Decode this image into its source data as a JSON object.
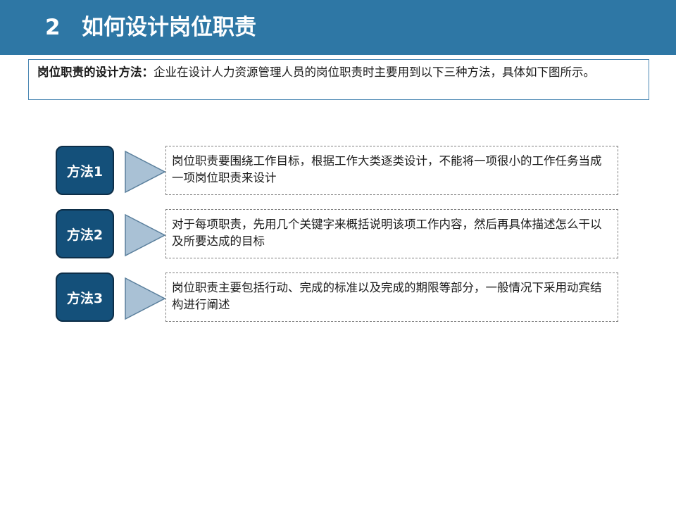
{
  "header": {
    "number": "2",
    "title": "如何设计岗位职责",
    "color": "#2e77a5"
  },
  "intro": {
    "lead": "岗位职责的设计方法：",
    "text": "企业在设计人力资源管理人员的岗位职责时主要用到以下三种方法，具体如下图所示。"
  },
  "methods": [
    {
      "label": "方法1",
      "text": "岗位职责要围绕工作目标，根据工作大类逐类设计，不能将一项很小的工作任务当成一项岗位职责来设计"
    },
    {
      "label": "方法2",
      "text": "对于每项职责，先用几个关键字来概括说明该项工作内容，然后再具体描述怎么干以及所要达成的目标"
    },
    {
      "label": "方法3",
      "text": "岗位职责主要包括行动、完成的标准以及完成的期限等部分，一般情况下采用动宾结构进行阐述"
    }
  ],
  "colors": {
    "badge": "#14507a",
    "arrow_fill": "#a9c1d5",
    "arrow_stroke": "#5a7f9c",
    "box_border": "#7f7f7f"
  }
}
